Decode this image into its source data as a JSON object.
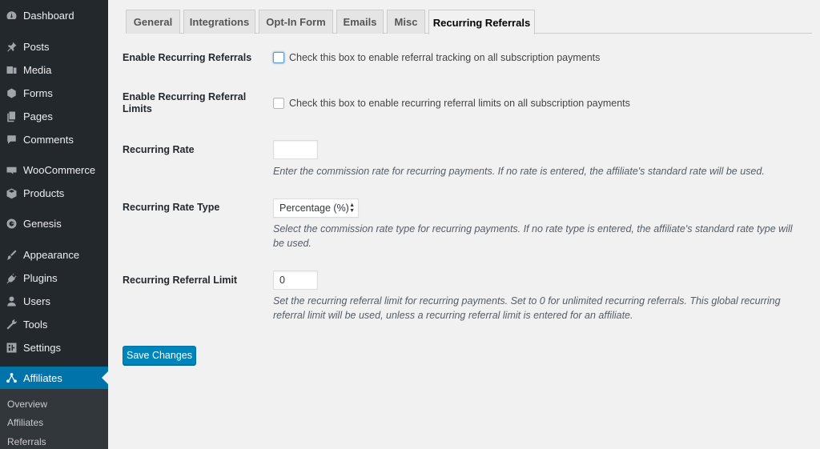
{
  "sidebar": {
    "items": [
      {
        "label": "Dashboard",
        "icon": "dashboard-icon"
      },
      {
        "label": "Posts",
        "icon": "pin-icon"
      },
      {
        "label": "Media",
        "icon": "media-icon"
      },
      {
        "label": "Forms",
        "icon": "forms-icon"
      },
      {
        "label": "Pages",
        "icon": "pages-icon"
      },
      {
        "label": "Comments",
        "icon": "comment-icon"
      },
      {
        "label": "WooCommerce",
        "icon": "woocommerce-icon"
      },
      {
        "label": "Products",
        "icon": "box-icon"
      },
      {
        "label": "Genesis",
        "icon": "genesis-icon"
      },
      {
        "label": "Appearance",
        "icon": "brush-icon"
      },
      {
        "label": "Plugins",
        "icon": "plug-icon"
      },
      {
        "label": "Users",
        "icon": "user-icon"
      },
      {
        "label": "Tools",
        "icon": "wrench-icon"
      },
      {
        "label": "Settings",
        "icon": "settings-icon"
      },
      {
        "label": "Affiliates",
        "icon": "affiliates-icon"
      }
    ],
    "submenu": [
      "Overview",
      "Affiliates",
      "Referrals"
    ]
  },
  "tabs": [
    "General",
    "Integrations",
    "Opt-In Form",
    "Emails",
    "Misc",
    "Recurring Referrals"
  ],
  "active_tab": "Recurring Referrals",
  "form": {
    "enable_recurring": {
      "label": "Enable Recurring Referrals",
      "text": "Check this box to enable referral tracking on all subscription payments"
    },
    "enable_limits": {
      "label_line1": "Enable Recurring Referral",
      "label_line2": "Limits",
      "text": "Check this box to enable recurring referral limits on all subscription payments"
    },
    "rate": {
      "label": "Recurring Rate",
      "value": "",
      "description": "Enter the commission rate for recurring payments. If no rate is entered, the affiliate's standard rate will be used."
    },
    "rate_type": {
      "label": "Recurring Rate Type",
      "selected": "Percentage (%)",
      "description_line1": "Select the commission rate type for recurring payments. If no rate type is entered, the affiliate's standard rate type will",
      "description_line2": "be used."
    },
    "limit": {
      "label": "Recurring Referral Limit",
      "value": "0",
      "description_line1": "Set the recurring referral limit for recurring payments. Set to 0 for unlimited recurring referrals. This global recurring",
      "description_line2": "referral limit will be used, unless a recurring referral limit is entered for an affiliate."
    },
    "save_label": "Save Changes"
  },
  "colors": {
    "sidebar_bg": "#23282d",
    "accent": "#0073aa",
    "button": "#0085ba",
    "content_bg": "#f1f1f1"
  }
}
